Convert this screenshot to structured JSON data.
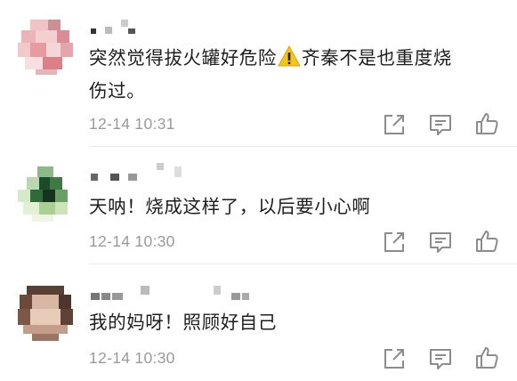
{
  "comments": [
    {
      "text_line1": "突然觉得拔火罐好危险",
      "text_line1_after": "齐秦不是也重度烧",
      "text_line2": "伤过。",
      "time": "12-14 10:31",
      "avatar_color": "#e8a0a4"
    },
    {
      "text": "天呐！烧成这样了，以后要小心啊",
      "time": "12-14 10:30",
      "avatar_color": "#2f6b3a"
    },
    {
      "text": "我的妈呀！照顾好自己",
      "time": "12-14 10:30",
      "avatar_color": "#6b4a3c"
    }
  ],
  "actions": {
    "repost_icon": "share-box-icon",
    "reply_icon": "chat-bubble-icon",
    "like_icon": "thumbs-up-icon"
  },
  "colors": {
    "text": "#1e1e1e",
    "timestamp": "#9a9a9a",
    "divider": "#ebebeb",
    "icon": "#8c8c8c",
    "warning": "#f5c518"
  }
}
